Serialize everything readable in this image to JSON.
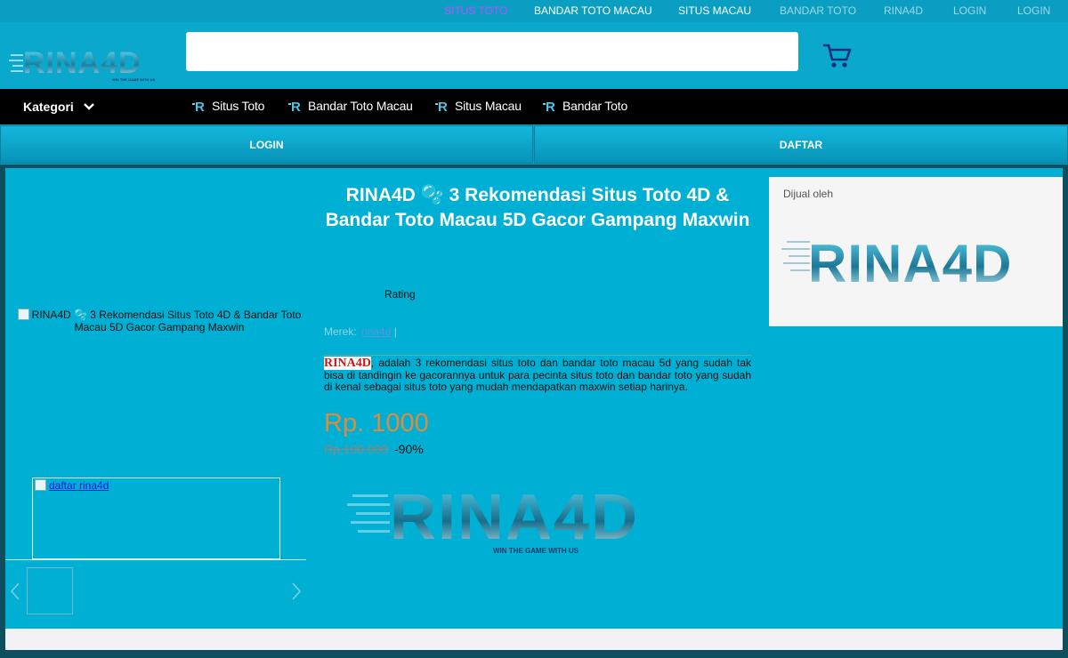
{
  "topnav": [
    "SITUS TOTO",
    "BANDAR TOTO MACAU",
    "SITUS MACAU",
    "BANDAR TOTO",
    "RINA4D",
    "LOGIN",
    "LOGIN"
  ],
  "header": {
    "logo_text": "RINA4D",
    "logo_tagline": "WIN THE GAME WITH US",
    "search_placeholder": "",
    "cart_icon": "shopping-cart-icon"
  },
  "catbar": {
    "kategori": "Kategori",
    "links": [
      "Situs Toto",
      "Bandar Toto Macau",
      "Situs Macau",
      "Bandar Toto"
    ]
  },
  "auth": {
    "login": "LOGIN",
    "daftar": "DAFTAR"
  },
  "gallery": {
    "main_alt": "RINA4D 🫧 3 Rekomendasi Situs Toto 4D & Bandar Toto Macau 5D Gacor Gampang Maxwin",
    "daftar_alt": "daftar rina4d"
  },
  "product": {
    "title": "RINA4D 🫧 3 Rekomendasi Situs Toto 4D & Bandar Toto Macau 5D Gacor Gampang Maxwin",
    "rating_label": "Rating",
    "merek_label": "Merek:",
    "merek_value": "rina4d",
    "merek_sep": "|",
    "desc_brand": "RINA4D",
    "desc_text": ", adalah 3 rekomendasi situs toto dan bandar toto macau 5d yang sudah tak bisa di tandingin ke gacorannya untuk para pecinta situs toto dan bandar toto yang sudah di kenal sebagai situs toto yang mudah mendapatkan maxwin setiap harinya.",
    "price": "Rp. 1000",
    "old_price": "Rp.100.000",
    "discount": "-90%"
  },
  "seller": {
    "label": "Dijual oleh",
    "logo_text": "RINA4D"
  },
  "colors": {
    "topnav_bg": "#0a9fc2",
    "header_bg": "#0aa8cd",
    "main_bg": "#00b0d4",
    "price": "#e08a3c",
    "highlight_link": "#c04cff"
  }
}
